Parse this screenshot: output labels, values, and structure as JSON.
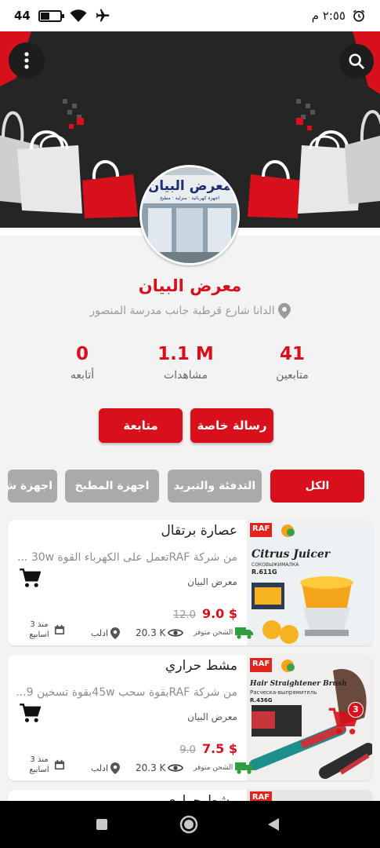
{
  "status_bar": {
    "battery_level_text": "44",
    "battery_fraction": 0.44,
    "time": "٢:٥٥ م",
    "icons": [
      "battery-icon",
      "wifi-icon",
      "airplane-icon",
      "alarm-icon"
    ]
  },
  "header": {
    "menu_icon": "more-vertical-icon",
    "search_icon": "search-icon",
    "avatar_sign_text": "معرض البيان",
    "avatar_sign_subtext": "اجهزة كهربائية · منزلية · مطبخ"
  },
  "store": {
    "name": "معرض البيان",
    "address": "الدانا شارع قرطبة جانب مدرسة المنصور"
  },
  "stats": [
    {
      "value": "41",
      "label": "متابعين"
    },
    {
      "value": "1.1 M",
      "label": "مشاهدات"
    },
    {
      "value": "0",
      "label": "أتابعه"
    }
  ],
  "actions": {
    "message_label": "رسالة خاصة",
    "follow_label": "متابعة"
  },
  "categories": [
    {
      "label": "الكل",
      "active": true
    },
    {
      "label": "التدفئة والتبريد",
      "active": false
    },
    {
      "label": "اجهزة المطبخ",
      "active": false
    },
    {
      "label": "اجهزة ش",
      "active": false
    }
  ],
  "products": [
    {
      "title": "عصارة برتقال",
      "description": "من شركة RAFتعمل على الكهرباء القوة 30w ...",
      "seller": "معرض البيان",
      "price": "$ 9.0",
      "old_price": "12.0",
      "shipping": "الشحن متوفر",
      "views": "20.3 K",
      "location": "ادلب",
      "age": "منذ 3 اسابيع",
      "image_brand": "RAF",
      "image_title": "Citrus Juicer",
      "image_subtitle": "СОКОВЫЖИМАЛКА",
      "image_model": "R.611G"
    },
    {
      "title": "مشط حراري",
      "description": "من شركة RAFبقوة سحب 45wبقوة تسخين 9...",
      "seller": "معرض البيان",
      "price": "$ 7.5",
      "old_price": "9.0",
      "shipping": "الشحن متوفر",
      "views": "20.3 K",
      "location": "ادلب",
      "age": "منذ 3 اسابيع",
      "image_brand": "RAF",
      "image_title": "Hair Straightener Brush",
      "image_subtitle": "Расческа-выпрямитель",
      "image_model": "R.436G"
    },
    {
      "title": "مشط حراري",
      "image_brand": "RAF"
    }
  ],
  "floating_cart": {
    "count": "3"
  },
  "colors": {
    "accent": "#d8101c",
    "banner_dark": "#262526",
    "chip_inactive": "#aaaaaa",
    "shipping_green": "#2e9e3e"
  },
  "nav_bar": {
    "icons": [
      "recent-apps-icon",
      "home-icon",
      "back-icon"
    ]
  }
}
